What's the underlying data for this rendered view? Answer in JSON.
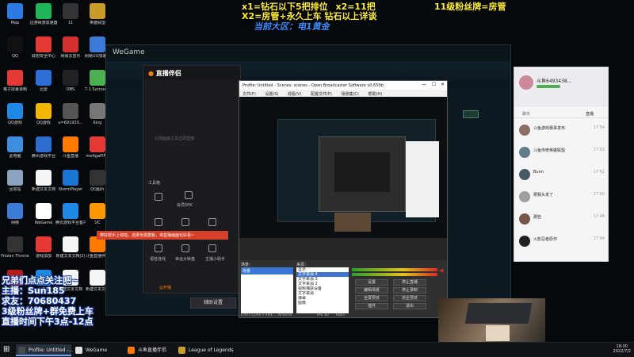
{
  "overlay": {
    "top_line1": "x1=钻石以下5把排位",
    "top_line1b": "x2=11把",
    "top_line2": "X2=房管+永久上车  钻石以上详谈",
    "top_right": "11级粉丝牌=房管",
    "region": "当前大区：电1黄金",
    "left_lines": [
      "兄弟们点点关注吧~",
      "主播：Sun185",
      "求友：70680437",
      "3级粉丝牌+群免费上车",
      "直播时间下午3点-12点"
    ]
  },
  "desktop_icons": [
    {
      "label": "Map",
      "color": "#2c7be5"
    },
    {
      "label": "迅游网游加速器",
      "color": "#1fb65a"
    },
    {
      "label": "11",
      "color": "#333333"
    },
    {
      "label": "英雄联盟",
      "color": "#c99c2a"
    },
    {
      "label": "QQ",
      "color": "#111111"
    },
    {
      "label": "联想安全中心",
      "color": "#e53935"
    },
    {
      "label": "网易云音乐",
      "color": "#d32f2f"
    },
    {
      "label": "网易UU加速器",
      "color": "#3b7ad9"
    },
    {
      "label": "格子屏幕录制",
      "color": "#e53935"
    },
    {
      "label": "迅雷",
      "color": "#2c6fd6"
    },
    {
      "label": "OBS",
      "color": "#222222"
    },
    {
      "label": "7.1 Surround",
      "color": "#4caf50"
    },
    {
      "label": "QQ游戏",
      "color": "#1e88e5"
    },
    {
      "label": "QQ游戏",
      "color": "#f2b705"
    },
    {
      "label": "u=691933...",
      "color": "#555555"
    },
    {
      "label": "6ing",
      "color": "#777777"
    },
    {
      "label": "此电脑",
      "color": "#3d8de0"
    },
    {
      "label": "腾讯游戏平台",
      "color": "#2d6ccf"
    },
    {
      "label": "斗鱼直播",
      "color": "#ff7a00"
    },
    {
      "label": "meAgaPIF...",
      "color": "#e53935"
    },
    {
      "label": "回收站",
      "color": "#8aa4c0"
    },
    {
      "label": "新建文本文档",
      "color": "#f5f5f5"
    },
    {
      "label": "StormPlayer",
      "color": "#1976d2"
    },
    {
      "label": "QQ图片",
      "color": "#333333"
    },
    {
      "label": "网络",
      "color": "#3a7bd5"
    },
    {
      "label": "WeGame",
      "color": "#ffffff"
    },
    {
      "label": "腾讯游戏平台客户端",
      "color": "#1e88e5"
    },
    {
      "label": "UC",
      "color": "#ff9800"
    },
    {
      "label": "Frozen Throne",
      "color": "#333333"
    },
    {
      "label": "游戏加加",
      "color": "#e53935"
    },
    {
      "label": "新建文本文档(2)",
      "color": "#f5f5f5"
    },
    {
      "label": "斗鱼直播伴侣",
      "color": "#ff7a00"
    },
    {
      "label": "自由模式",
      "color": "#b71c1c"
    },
    {
      "label": "小黑盒",
      "color": "#1e88e5"
    },
    {
      "label": "新建文本文档",
      "color": "#f5f5f5"
    },
    {
      "label": "新建文本文档",
      "color": "#f5f5f5"
    }
  ],
  "wegame": {
    "title": "WeGame"
  },
  "zhibo": {
    "title": "直播伴侣",
    "placeholder": "右侧画面工具立即直播",
    "section": "工具箱",
    "tools": [
      "会员5PK",
      "直播PK",
      "游戏",
      "语音连线",
      "幸运大转盘",
      "主播小助手"
    ],
    "footer_left": "@开播",
    "footer_btn": "辅助设置",
    "red_bar": "带好帮手上线啦，选择专属模板，将直播画面化好看~"
  },
  "obs": {
    "title": "Profile: Untitled - Scenes: scenes - Open Broadcaster Software v0.659b",
    "menu": [
      "文件(F)",
      "设置(S)",
      "观看(V)",
      "配置文件(P)",
      "场景集(C)",
      "帮助(H)"
    ],
    "scenes_label": "场景：",
    "sources_label": "来源：",
    "scene_item": "场景",
    "sources": [
      "显示",
      "文字来源 4",
      "文字来源 3",
      "文字来源 2",
      "视频捕获设备",
      "文字来源",
      "弹幕",
      "图像"
    ],
    "buttons": [
      "设置",
      "停止直播",
      "编辑场景",
      "停止录制",
      "全屏预览",
      "完全预览",
      "插件",
      "退出"
    ],
    "status": "0.00 s  CLIVE + RIVE  ...  00:00:00",
    "fps": "FPS: 60",
    "kbps": "0kb/s"
  },
  "chat": {
    "username": "斗鱼6493438...",
    "tabs": [
      "聊天",
      "直播"
    ],
    "rows": [
      {
        "name": "斗鱼游戏赛事发布",
        "time": "17:54"
      },
      {
        "name": "斗鱼传奇英雄联盟",
        "time": "17:53"
      },
      {
        "name": "Bunn",
        "time": "17:52"
      },
      {
        "name": "那我头发了",
        "time": "17:50"
      },
      {
        "name": "那些",
        "time": "17:48"
      },
      {
        "name": "火影忍者原作",
        "time": "17:44"
      }
    ]
  },
  "taskbar": {
    "items": [
      {
        "label": "Profile: Untitled -...",
        "color": "#4a4a4a"
      },
      {
        "label": "WeGame",
        "color": "#e0e0e0"
      },
      {
        "label": "斗鱼直播伴侣",
        "color": "#ff7a00"
      },
      {
        "label": "League of Legends",
        "color": "#c99c2a"
      }
    ],
    "time": "18:00",
    "date": "2022/7/2"
  },
  "colors": {
    "overlay_yellow": "#ffee33",
    "overlay_blue": "#3c8cff",
    "obs_red": "#d62d20"
  }
}
